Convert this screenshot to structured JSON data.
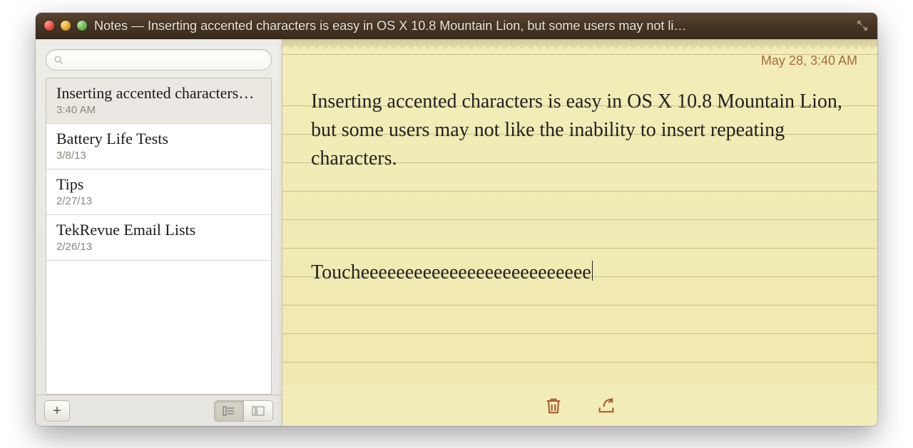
{
  "window": {
    "title": "Notes — Inserting accented characters is easy in OS X 10.8 Mountain Lion, but some users may not li…"
  },
  "search": {
    "placeholder": ""
  },
  "notes": [
    {
      "title": "Inserting accented characters…",
      "date": "3:40 AM",
      "selected": true
    },
    {
      "title": "Battery Life Tests",
      "date": "3/8/13",
      "selected": false
    },
    {
      "title": "Tips",
      "date": "2/27/13",
      "selected": false
    },
    {
      "title": "TekRevue Email Lists",
      "date": "2/26/13",
      "selected": false
    }
  ],
  "current_note": {
    "timestamp": "May 28, 3:40 AM",
    "body": "Inserting accented characters is easy in OS X 10.8 Mountain Lion, but some users may not like the inability to insert repeating characters.\n\n\n\nToucheeeeeeeeeeeeeeeeeeeeeeeeee"
  }
}
